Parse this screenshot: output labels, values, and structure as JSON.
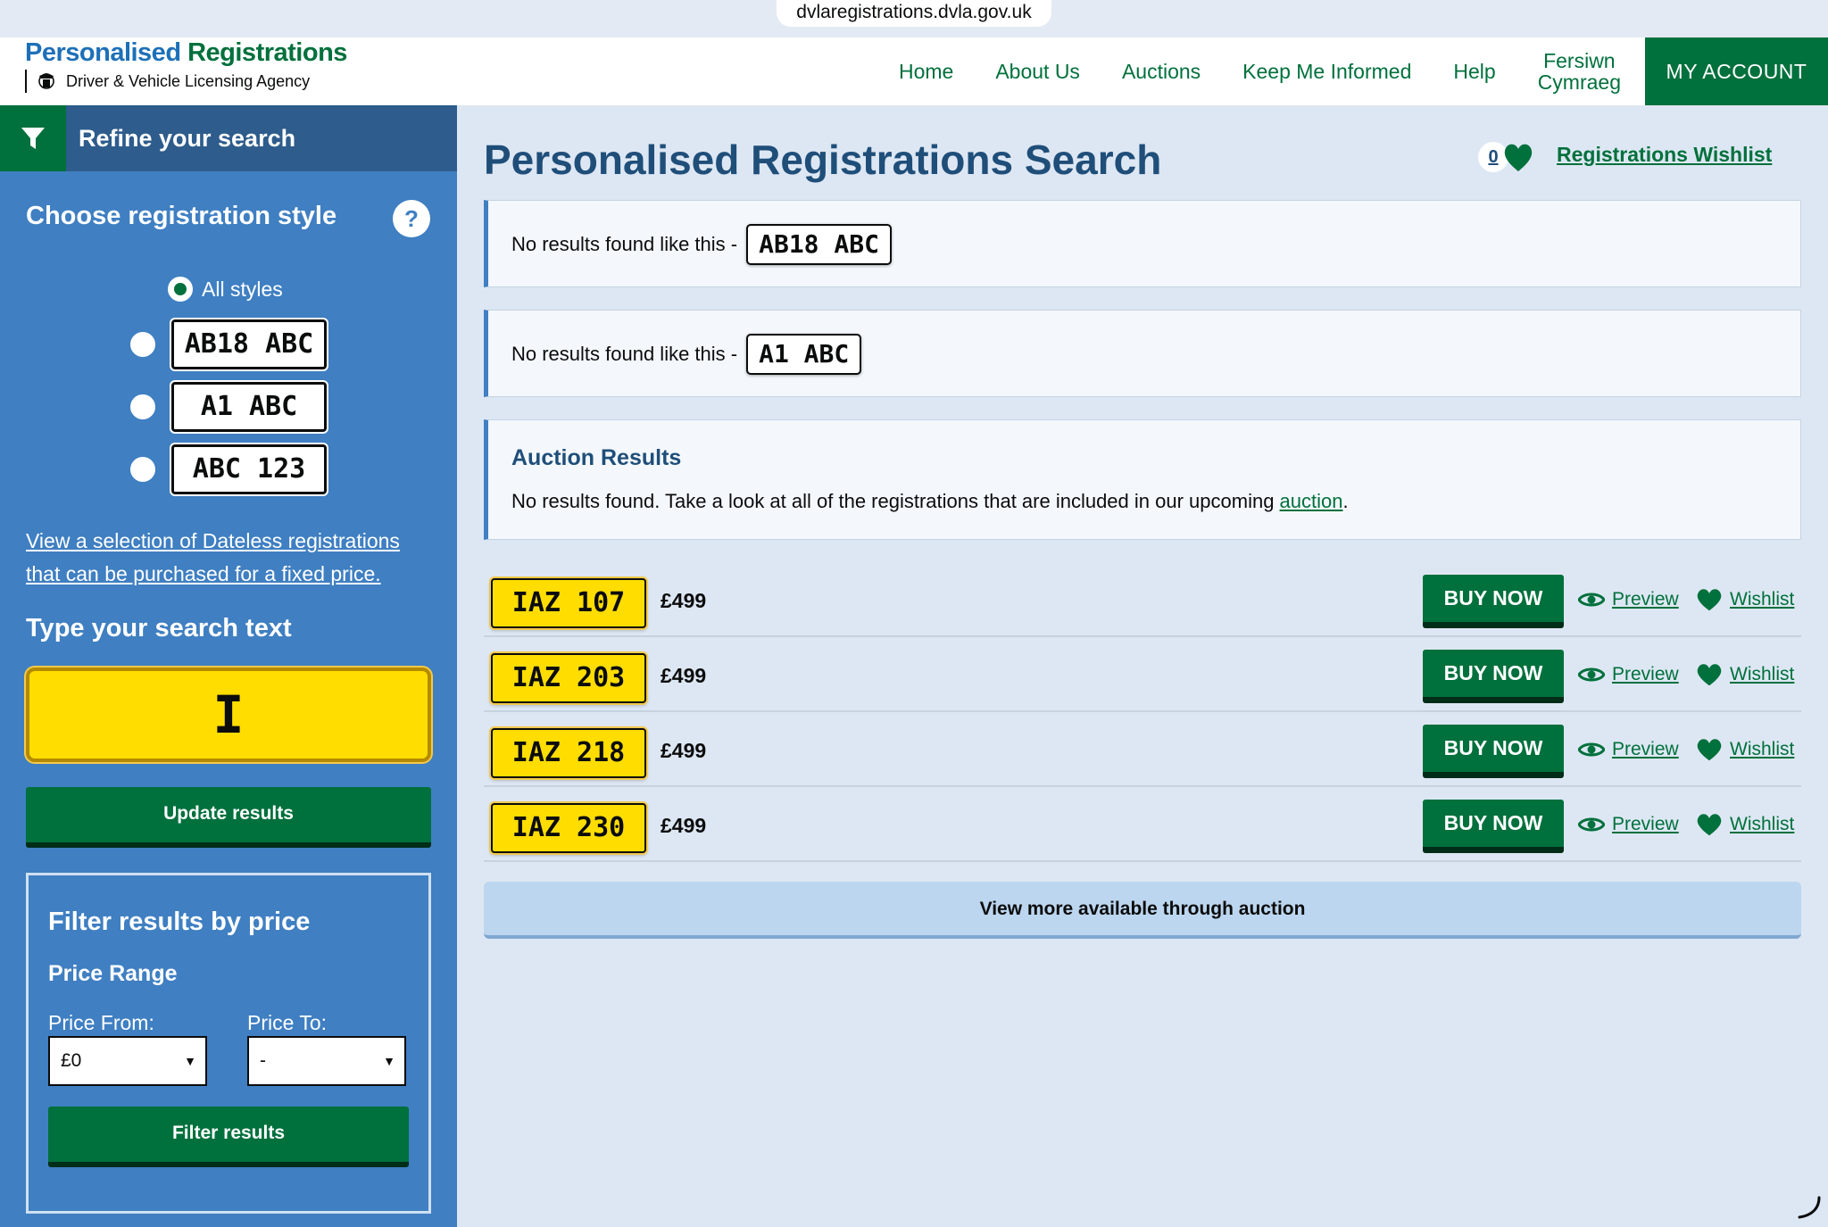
{
  "browser": {
    "url": "dvlaregistrations.dvla.gov.uk"
  },
  "brand": {
    "title_a": "Personalised ",
    "title_b": "Registrations",
    "subtitle": "Driver & Vehicle Licensing Agency"
  },
  "nav": {
    "items": [
      "Home",
      "About Us",
      "Auctions",
      "Keep Me Informed",
      "Help"
    ],
    "welsh_line1": "Fersiwn",
    "welsh_line2": "Cymraeg",
    "account": "MY ACCOUNT"
  },
  "sidebar": {
    "header": "Refine your search",
    "style_title": "Choose registration style",
    "help": "?",
    "all_styles": "All styles",
    "styles": [
      "AB18 ABC",
      "A1 ABC",
      "ABC 123"
    ],
    "dateless_link": "View a selection of Dateless registrations that can be purchased for a fixed price.",
    "search_title": "Type your search text",
    "search_value": "I",
    "update_button": "Update results",
    "filter": {
      "title": "Filter results by price",
      "range": "Price Range",
      "from_label": "Price From:",
      "to_label": "Price To:",
      "from_value": "£0",
      "to_value": "-",
      "button": "Filter results"
    }
  },
  "main": {
    "title": "Personalised Registrations Search",
    "wishlist_count": "0",
    "wishlist_link": "Registrations Wishlist",
    "no_results": [
      {
        "text": "No results found like this -",
        "plate": "AB18 ABC"
      },
      {
        "text": "No results found like this -",
        "plate": "A1 ABC"
      }
    ],
    "auction": {
      "title": "Auction Results",
      "text_before": "No results found. Take a look at all of the registrations that are included in our upcoming ",
      "link": "auction",
      "text_after": "."
    },
    "results": [
      {
        "plate": "IAZ 107",
        "price": "£499",
        "buy": "BUY NOW",
        "preview": "Preview",
        "wishlist": "Wishlist"
      },
      {
        "plate": "IAZ 203",
        "price": "£499",
        "buy": "BUY NOW",
        "preview": "Preview",
        "wishlist": "Wishlist"
      },
      {
        "plate": "IAZ 218",
        "price": "£499",
        "buy": "BUY NOW",
        "preview": "Preview",
        "wishlist": "Wishlist"
      },
      {
        "plate": "IAZ 230",
        "price": "£499",
        "buy": "BUY NOW",
        "preview": "Preview",
        "wishlist": "Wishlist"
      }
    ],
    "view_more": "View more available through auction"
  },
  "colors": {
    "brand_green": "#00703c",
    "brand_blue": "#1d70b8",
    "sidebar_blue": "#3f7fc2",
    "plate_yellow": "#ffdd00"
  },
  "icons": [
    "filter-icon",
    "question-icon",
    "heart-icon",
    "eye-icon",
    "crest-icon",
    "spinner-icon"
  ]
}
